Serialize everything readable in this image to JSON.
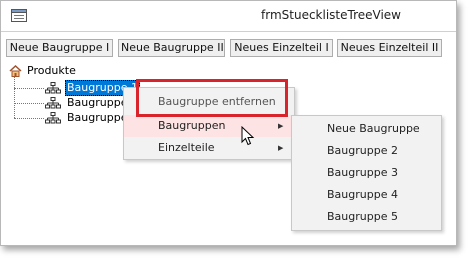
{
  "window": {
    "title": "frmStuecklisteTreeView"
  },
  "toolbar": {
    "buttons": [
      "Neue Baugruppe I",
      "Neue Baugruppe II",
      "Neues Einzelteil I",
      "Neues Einzelteil II"
    ]
  },
  "tree": {
    "root": {
      "label": "Produkte",
      "icon": "home-icon"
    },
    "children": [
      {
        "label": "Baugruppe 1",
        "icon": "hierarchy-icon",
        "selected": true
      },
      {
        "label": "Baugruppe 2",
        "icon": "hierarchy-icon",
        "selected": false
      },
      {
        "label": "Baugruppe 3",
        "icon": "hierarchy-icon",
        "selected": false
      }
    ]
  },
  "context_menu": {
    "items": [
      {
        "label": "Baugruppe entfernen",
        "has_submenu": false,
        "highlighted": false
      },
      {
        "label": "Baugruppen",
        "has_submenu": true,
        "highlighted": true
      },
      {
        "label": "Einzelteile",
        "has_submenu": true,
        "highlighted": false
      }
    ]
  },
  "submenu": {
    "items": [
      "Neue Baugruppe",
      "Baugruppe 2",
      "Baugruppe 3",
      "Baugruppe 4",
      "Baugruppe 5"
    ]
  },
  "colors": {
    "selection": "#0078d7",
    "highlight_box": "#d9242b",
    "menu_highlight": "#fde3e3"
  }
}
